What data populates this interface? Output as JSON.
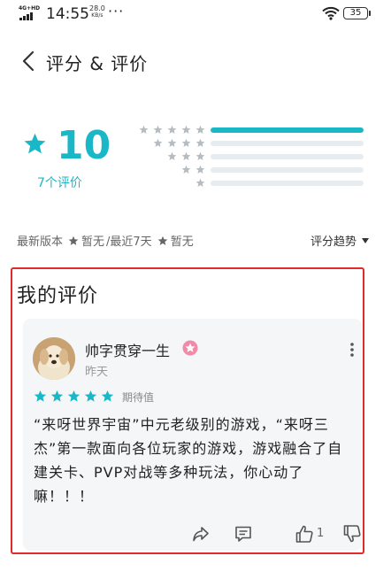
{
  "status_bar": {
    "network": "4G+HD",
    "time": "14:55",
    "speed_value": "28.0",
    "speed_unit": "KB/s",
    "dots": "···",
    "battery": "35"
  },
  "header": {
    "title": "评分 & 评价"
  },
  "rating_summary": {
    "score": "10",
    "count_label": "7个评价",
    "accent_color": "#1ab8c6",
    "distribution": [
      {
        "stars": 5,
        "fraction": 1.0
      },
      {
        "stars": 4,
        "fraction": 0.0
      },
      {
        "stars": 3,
        "fraction": 0.0
      },
      {
        "stars": 2,
        "fraction": 0.0
      },
      {
        "stars": 1,
        "fraction": 0.0
      }
    ]
  },
  "filter": {
    "latest_version": "最新版本",
    "none_1": "暂无",
    "recent_7": "/最近7天",
    "none_2": "暂无",
    "trend": "评分趋势"
  },
  "my_review": {
    "section_title": "我的评价",
    "username": "帅字贯穿一生",
    "time": "昨天",
    "stars": 5,
    "rating_label": "期待值",
    "text": "“来呀世界宇宙”中元老级别的游戏，“来呀三杰”第一款面向各位玩家的游戏，游戏融合了自建关卡、PVP对战等多种玩法，你心动了嘛！！！",
    "like_count": "1",
    "highlight_color": "#e02b2b"
  }
}
